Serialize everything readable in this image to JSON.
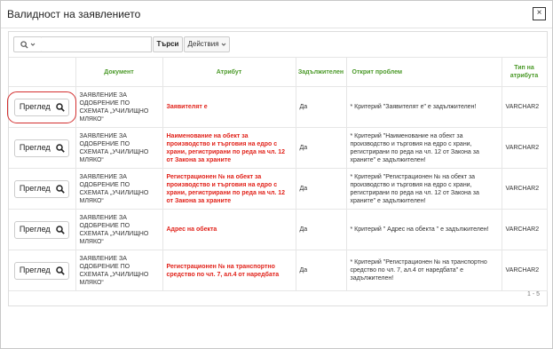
{
  "dialog": {
    "title": "Валидност на заявлението",
    "close_label": "×"
  },
  "toolbar": {
    "search_placeholder": "",
    "search_button": "Търси",
    "actions_label": "Действия"
  },
  "table": {
    "headers": [
      "",
      "Документ",
      "Атрибут",
      "Задължителен",
      "Открит проблем",
      "Тип на атрибута"
    ],
    "rows": [
      {
        "button": "Преглед",
        "document": "ЗАЯВЛЕНИЕ ЗА ОДОБРЕНИЕ ПО СХЕМАТА „УЧИЛИЩНО МЛЯКО“",
        "attribute": "Заявителят е",
        "required": "Да",
        "problem": "* Критерий \"Заявителят е\" е задължителен!",
        "type": "VARCHAR2"
      },
      {
        "button": "Преглед",
        "document": "ЗАЯВЛЕНИЕ ЗА ОДОБРЕНИЕ ПО СХЕМАТА „УЧИЛИЩНО МЛЯКО“",
        "attribute": "Наименование на обект за производство и търговия на едро с храни, регистрирани по реда на чл. 12 от Закона за храните",
        "required": "Да",
        "problem": "* Критерий \"Наименование на обект за производство и търговия на едро с храни, регистрирани по реда на чл. 12 от Закона за храните\" е задължителен!",
        "type": "VARCHAR2"
      },
      {
        "button": "Преглед",
        "document": "ЗАЯВЛЕНИЕ ЗА ОДОБРЕНИЕ ПО СХЕМАТА „УЧИЛИЩНО МЛЯКО“",
        "attribute": "Регистрационен № на обект за производство и търговия на едро с храни, регистрирани по реда на чл. 12 от Закона за храните",
        "required": "Да",
        "problem": "* Критерий \"Регистрационен № на обект за производство и търговия на едро с храни, регистрирани по реда на чл. 12 от Закона за храните\" е задължителен!",
        "type": "VARCHAR2"
      },
      {
        "button": "Преглед",
        "document": "ЗАЯВЛЕНИЕ ЗА ОДОБРЕНИЕ ПО СХЕМАТА „УЧИЛИЩНО МЛЯКО“",
        "attribute": "Адрес на обекта",
        "required": "Да",
        "problem": "* Критерий \" Адрес на обекта \" е задължителен!",
        "type": "VARCHAR2"
      },
      {
        "button": "Преглед",
        "document": "ЗАЯВЛЕНИЕ ЗА ОДОБРЕНИЕ ПО СХЕМАТА „УЧИЛИЩНО МЛЯКО“",
        "attribute": "Регистрационен № на транспортно средство по чл. 7, ал.4 от наредбата",
        "required": "Да",
        "problem": "* Критерий \"Регистрационен № на транспортно средство по чл. 7, ал.4 от наредбата\" е задължителен!",
        "type": "VARCHAR2"
      }
    ]
  },
  "pagination": {
    "text": "1 - 5"
  },
  "colors": {
    "header_green": "#4c9a2a",
    "attribute_red": "#e1231b",
    "highlight_red": "#d32f2f"
  },
  "icons": {
    "search": "search-icon",
    "chevron": "chevron-down-icon",
    "close": "close-icon"
  }
}
